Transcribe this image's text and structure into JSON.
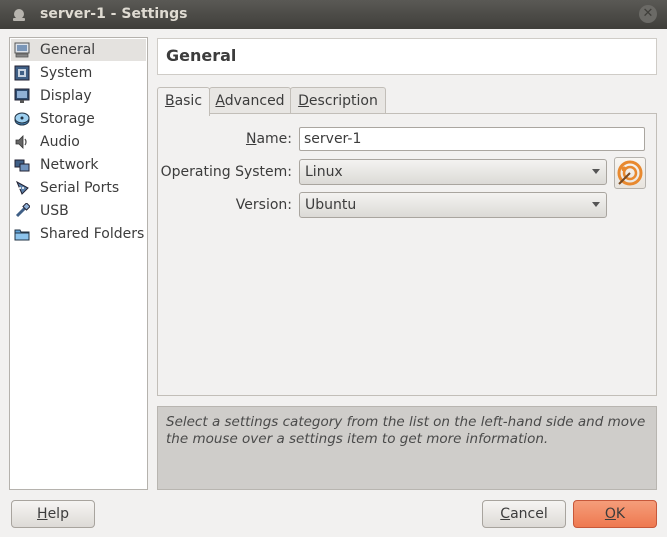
{
  "window": {
    "title": "server-1 - Settings"
  },
  "sidebar": {
    "items": [
      {
        "label": "General",
        "icon": "general-icon",
        "selected": true
      },
      {
        "label": "System",
        "icon": "system-icon"
      },
      {
        "label": "Display",
        "icon": "display-icon"
      },
      {
        "label": "Storage",
        "icon": "storage-icon"
      },
      {
        "label": "Audio",
        "icon": "audio-icon"
      },
      {
        "label": "Network",
        "icon": "network-icon"
      },
      {
        "label": "Serial Ports",
        "icon": "serial-ports-icon"
      },
      {
        "label": "USB",
        "icon": "usb-icon"
      },
      {
        "label": "Shared Folders",
        "icon": "shared-folders-icon"
      }
    ]
  },
  "header": {
    "title": "General"
  },
  "tabs": [
    {
      "label": "Basic",
      "mnemonic": "B",
      "rest": "asic",
      "active": true
    },
    {
      "label": "Advanced",
      "mnemonic": "A",
      "rest": "dvanced"
    },
    {
      "label": "Description",
      "mnemonic": "D",
      "rest": "escription"
    }
  ],
  "form": {
    "name_label_mn": "N",
    "name_label_rest": "ame:",
    "name_value": "server-1",
    "os_label": "Operating System:",
    "os_value": "Linux",
    "version_label": "Version:",
    "version_value": "Ubuntu"
  },
  "info": {
    "text": "Select a settings category from the list on the left-hand side and move the mouse over a settings item to get more information."
  },
  "buttons": {
    "help_mn": "H",
    "help_rest": "elp",
    "cancel_mn": "C",
    "cancel_rest": "ancel",
    "ok_mn": "O",
    "ok_rest": "K"
  },
  "colors": {
    "accent": "#ee7950",
    "selection": "#e4e2df"
  }
}
